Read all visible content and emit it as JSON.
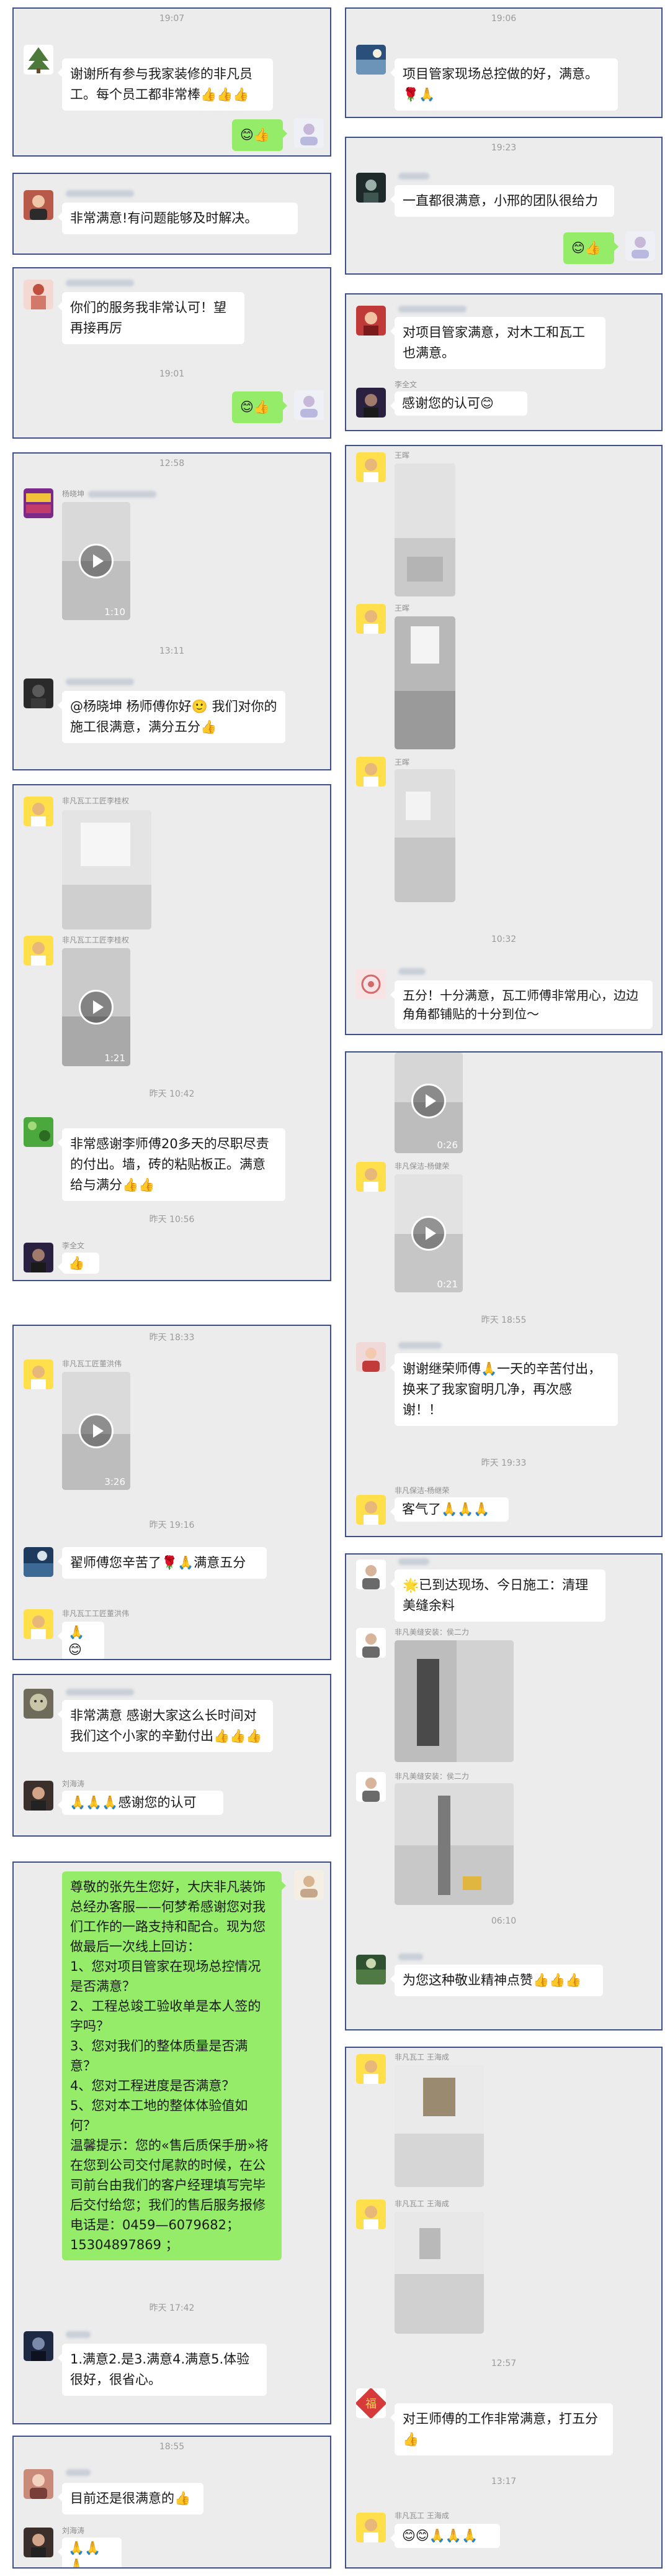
{
  "c1": {
    "ts": "19:07",
    "msg": "谢谢所有参与我家装修的非凡员工。每个员工都非常棒👍👍👍",
    "reply": "😊👍"
  },
  "c2": {
    "msg": "非常满意!有问题能够及时解决。"
  },
  "c3": {
    "msg": "你们的服务我非常认可！望再接再厉",
    "ts": "19:01",
    "reply": "😊👍"
  },
  "c4": {
    "ts1": "12:58",
    "name1": "杨晓坤",
    "dur": "1:10",
    "ts2": "13:11",
    "name2": "",
    "msg": "@杨晓坤 杨师傅你好🙂 我们对你的施工很满意，满分五分👍"
  },
  "c5": {
    "name1": "非凡瓦工工匠李桂权",
    "name2": "非凡瓦工工匠李桂权",
    "dur": "1:21",
    "ts1": "昨天 10:42",
    "msg": "非常感谢李师傅20多天的尽职尽责的付出。墙，砖的粘贴板正。满意给与满分👍👍",
    "ts2": "昨天 10:56",
    "name3": "李全文",
    "reply": "👍"
  },
  "c6": {
    "ts1": "昨天 18:33",
    "name1": "非凡瓦工匠董洪伟",
    "dur": "3:26",
    "ts2": "昨天 19:16",
    "msg": "翟师傅您辛苦了🌹🙏满意五分",
    "name2": "非凡瓦工工匠董洪伟",
    "reply": "🙏😊"
  },
  "c7": {
    "msg": "非常满意 感谢大家这么长时间对我们这个小家的辛勤付出👍👍👍",
    "name2": "刘海涛",
    "reply": "🙏🙏🙏感谢您的认可"
  },
  "c8": {
    "msg": "尊敬的张先生您好，大庆非凡装饰总经办客服——何梦希感谢您对我们工作的一路支持和配合。现为您做最后一次线上回访：\n1、您对项目管家在现场总控情况是否满意？\n2、工程总竣工验收单是本人签的字吗？\n3、您对我们的整体质量是否满意？\n4、您对工程进度是否满意？\n5、您对本工地的整体体验值如何？\n温馨提示：您的«售后质保手册»将在您到公司交付尾款的时候，在公司前台由我们的客户经理填写完毕后交付给您；我们的售后服务报修电话是：0459—6079682；15304897869 ；",
    "ts": "昨天 17:42",
    "reply": "1.满意2.是3.满意4.满意5.体验很好，很省心。"
  },
  "c9": {
    "ts": "18:55",
    "msg": "目前还是很满意的👍",
    "name2": "刘海涛",
    "reply": "🙏🙏🙏"
  },
  "r1": {
    "ts": "19:06",
    "msg": "项目管家现场总控做的好，满意。🌹🙏"
  },
  "r2": {
    "ts": "19:23",
    "msg": "一直都很满意，小邢的团队很给力",
    "reply": "😊👍"
  },
  "r3": {
    "msg": "对项目管家满意，对木工和瓦工也满意。",
    "name2": "李全文",
    "reply": "感谢您的认可😊"
  },
  "r4": {
    "name1": "王晖",
    "name2": "王晖",
    "name3": "王晖",
    "ts": "10:32",
    "msg": "五分！十分满意，瓦工师傅非常用心，边边角角都铺贴的十分到位～"
  },
  "r5": {
    "dur1": "0:26",
    "name1": "非凡保洁-杨健荣",
    "dur2": "0:21",
    "ts1": "昨天 18:55",
    "msg": "谢谢继荣师傅🙏一天的辛苦付出，换来了我家窗明几净，再次感谢！！",
    "ts2": "昨天 19:33",
    "name2": "非凡保洁-杨继荣",
    "reply": "客气了🙏🙏🙏"
  },
  "r6": {
    "msg": "🌟已到达现场、今日施工：清理美缝余料",
    "name1": "非凡美缝安装：侯二力",
    "name2": "非凡美缝安装：侯二力",
    "ts": "06:10",
    "reply": "为您这种敬业精神点赞👍👍👍"
  },
  "r7": {
    "name1": "非凡瓦工 王海成",
    "name2": "非凡瓦工 王海成",
    "ts1": "12:57",
    "msg": "对王师傅的工作非常满意，打五分👍",
    "ts2": "13:17",
    "name3": "非凡瓦工 王海成",
    "reply": "😊😊🙏🙏🙏"
  }
}
